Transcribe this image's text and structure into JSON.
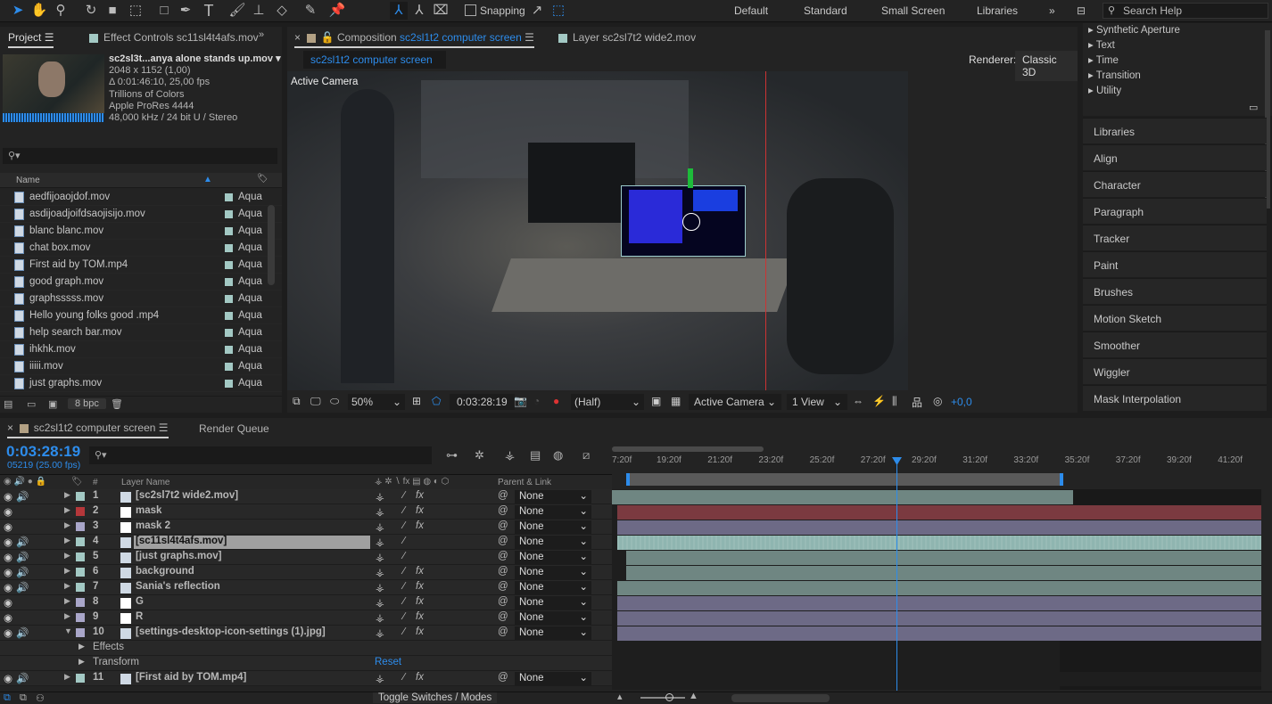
{
  "toolbar": {
    "snapping": "Snapping",
    "workspaces": [
      "Default",
      "Standard",
      "Small Screen",
      "Libraries"
    ],
    "search_placeholder": "Search Help"
  },
  "project": {
    "tab": "Project",
    "effect_tab": "Effect Controls sc11sl4t4afs.mov",
    "info": [
      "sc2sl3t...anya alone stands up.mov ▾",
      "2048 x 1152 (1,00)",
      "Δ 0:01:46:10, 25,00 fps",
      "Trillions of Colors",
      "Apple ProRes 4444",
      "48,000 kHz / 24 bit U / Stereo"
    ],
    "col_name": "Name",
    "bpc": "8 bpc",
    "items": [
      {
        "name": "aedfijoaojdof.mov",
        "label": "Aqua"
      },
      {
        "name": "asdijoadjoifdsaojisijo.mov",
        "label": "Aqua"
      },
      {
        "name": "blanc blanc.mov",
        "label": "Aqua"
      },
      {
        "name": "chat box.mov",
        "label": "Aqua"
      },
      {
        "name": "First aid by TOM.mp4",
        "label": "Aqua"
      },
      {
        "name": "good graph.mov",
        "label": "Aqua"
      },
      {
        "name": "graphsssss.mov",
        "label": "Aqua"
      },
      {
        "name": "Hello young folks good .mp4",
        "label": "Aqua"
      },
      {
        "name": "help search bar.mov",
        "label": "Aqua"
      },
      {
        "name": "ihkhk.mov",
        "label": "Aqua"
      },
      {
        "name": "iiiii.mov",
        "label": "Aqua"
      },
      {
        "name": "just graphs.mov",
        "label": "Aqua"
      }
    ]
  },
  "comp": {
    "tab_prefix": "Composition",
    "tab_name": "sc2sl1t2 computer screen",
    "layer_tab": "Layer sc2sl7t2 wide2.mov",
    "breadcrumb": "sc2sl1t2 computer screen",
    "renderer_label": "Renderer:",
    "renderer": "Classic 3D",
    "overlay": "Active Camera",
    "zoom": "50%",
    "time": "0:03:28:19",
    "resolution": "(Half)",
    "camera": "Active Camera",
    "views": "1 View",
    "exposure": "+0,0"
  },
  "right": {
    "effects": [
      "Synthetic Aperture",
      "Text",
      "Time",
      "Transition",
      "Utility"
    ],
    "panels": [
      "Libraries",
      "Align",
      "Character",
      "Paragraph",
      "Tracker",
      "Paint",
      "Brushes",
      "Motion Sketch",
      "Smoother",
      "Wiggler",
      "Mask Interpolation"
    ]
  },
  "timeline": {
    "tab": "sc2sl1t2 computer screen",
    "render_queue": "Render Queue",
    "timecode": "0:03:28:19",
    "frames": "05219 (25.00 fps)",
    "col_num": "#",
    "col_layer": "Layer Name",
    "col_parent": "Parent & Link",
    "toggle": "Toggle Switches / Modes",
    "reset": "Reset",
    "ruler": [
      "7:20f",
      "19:20f",
      "21:20f",
      "23:20f",
      "25:20f",
      "27:20f",
      "29:20f",
      "31:20f",
      "33:20f",
      "35:20f",
      "37:20f",
      "39:20f",
      "41:20f"
    ],
    "layers": [
      {
        "num": "1",
        "name": "[sc2sl7t2 wide2.mov]",
        "color": "#a3c9c4",
        "parent": "None",
        "type": "footage",
        "fx": true,
        "track": "#6f8682"
      },
      {
        "num": "2",
        "name": "mask",
        "color": "#b5373a",
        "parent": "None",
        "type": "solid",
        "fx": true,
        "track": "#7b3a40"
      },
      {
        "num": "3",
        "name": "mask 2",
        "color": "#a9a6c9",
        "parent": "None",
        "type": "solid",
        "fx": true,
        "track": "#6d6a86"
      },
      {
        "num": "4",
        "name": "[sc11sl4t4afs.mov]",
        "color": "#a3c9c4",
        "parent": "None",
        "type": "footage",
        "fx": false,
        "track": "#8fb5b0",
        "selected": true
      },
      {
        "num": "5",
        "name": "[just graphs.mov]",
        "color": "#a3c9c4",
        "parent": "None",
        "type": "footage",
        "fx": false,
        "track": "#6f8682"
      },
      {
        "num": "6",
        "name": "background",
        "color": "#a3c9c4",
        "parent": "None",
        "type": "footage",
        "fx": true,
        "track": "#6f8682"
      },
      {
        "num": "7",
        "name": "Sania's reflection",
        "color": "#a3c9c4",
        "parent": "None",
        "type": "footage",
        "fx": true,
        "track": "#6f8682"
      },
      {
        "num": "8",
        "name": "G",
        "color": "#a9a6c9",
        "parent": "None",
        "type": "solid",
        "fx": true,
        "track": "#6d6a86"
      },
      {
        "num": "9",
        "name": "R",
        "color": "#a9a6c9",
        "parent": "None",
        "type": "solid",
        "fx": true,
        "track": "#6d6a86"
      },
      {
        "num": "10",
        "name": "[settings-desktop-icon-settings (1).jpg]",
        "color": "#a9a6c9",
        "parent": "None",
        "type": "footage",
        "fx": true,
        "track": "#6d6a86"
      }
    ],
    "sub": [
      "Effects",
      "Transform"
    ],
    "layer11": {
      "num": "11",
      "name": "[First aid by TOM.mp4]",
      "color": "#a3c9c4",
      "parent": "None"
    }
  },
  "colors": {
    "accent": "#2d8ceb",
    "aqua": "#a3c9c4",
    "red": "#b5373a",
    "lavender": "#a9a6c9"
  }
}
